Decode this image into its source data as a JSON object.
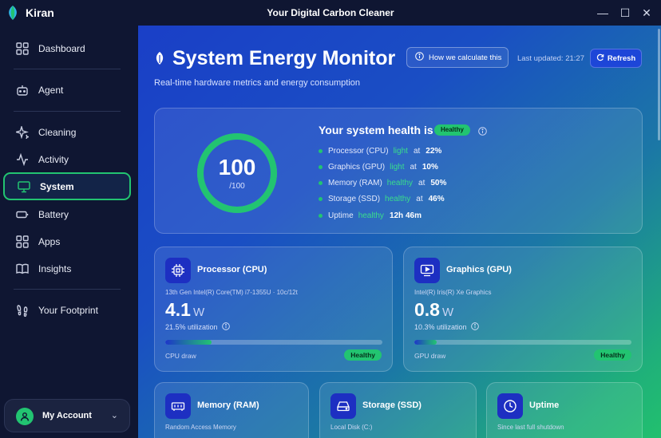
{
  "app": {
    "name": "Kiran",
    "window_title": "Your Digital Carbon Cleaner",
    "accent": "#22c471",
    "primary": "#1d46d8"
  },
  "window_controls": {
    "minimize": "—",
    "maximize": "☐",
    "close": "✕"
  },
  "sidebar": {
    "items": [
      {
        "label": "Dashboard",
        "icon": "grid-icon"
      },
      {
        "label": "Agent",
        "icon": "robot-icon"
      },
      {
        "label": "Cleaning",
        "icon": "sparkle-icon"
      },
      {
        "label": "Activity",
        "icon": "pulse-icon"
      },
      {
        "label": "System",
        "icon": "monitor-icon",
        "active": true
      },
      {
        "label": "Battery",
        "icon": "battery-icon"
      },
      {
        "label": "Apps",
        "icon": "apps-grid-icon"
      },
      {
        "label": "Insights",
        "icon": "book-icon"
      },
      {
        "label": "Your Footprint",
        "icon": "footprints-icon"
      }
    ],
    "account": {
      "label": "My Account"
    }
  },
  "header": {
    "title": "System Energy Monitor",
    "subtitle": "Real-time hardware metrics and energy consumption",
    "how_label": "How we calculate this",
    "updated": "Last updated: 21:27",
    "refresh_label": "Refresh"
  },
  "health": {
    "score": "100",
    "max": "/100",
    "score_fraction": 1.0,
    "title": "Your system health is",
    "badge": "Healthy",
    "rows": [
      {
        "key": "Processor (CPU)",
        "status": "light",
        "at": "at",
        "value": "22%"
      },
      {
        "key": "Graphics (GPU)",
        "status": "light",
        "at": "at",
        "value": "10%"
      },
      {
        "key": "Memory (RAM)",
        "status": "healthy",
        "at": "at",
        "value": "50%"
      },
      {
        "key": "Storage (SSD)",
        "status": "healthy",
        "at": "at",
        "value": "46%"
      },
      {
        "key": "Uptime",
        "status": "healthy",
        "at": "",
        "value": "12h 46m"
      }
    ]
  },
  "cpu": {
    "title": "Processor (CPU)",
    "model": "13th Gen Intel(R) Core(TM) i7-1355U · 10c/12t",
    "watts": "4.1",
    "unit": "W",
    "util": "21.5% utilization",
    "util_fraction": 0.215,
    "draw_label": "CPU draw",
    "badge": "Healthy"
  },
  "gpu": {
    "title": "Graphics (GPU)",
    "model": "Intel(R) Iris(R) Xe Graphics",
    "watts": "0.8",
    "unit": "W",
    "util": "10.3% utilization",
    "util_fraction": 0.103,
    "draw_label": "GPU draw",
    "badge": "Healthy"
  },
  "memory": {
    "title": "Memory (RAM)",
    "sub": "Random Access Memory"
  },
  "storage": {
    "title": "Storage (SSD)",
    "sub": "Local Disk (C:)"
  },
  "uptime": {
    "title": "Uptime",
    "sub": "Since last full shutdown"
  }
}
